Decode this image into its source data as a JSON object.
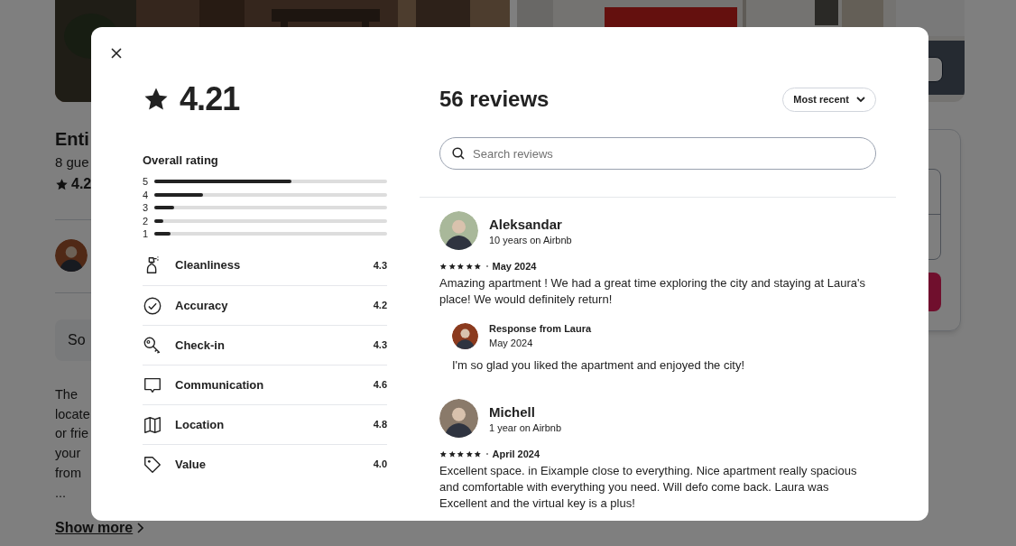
{
  "background": {
    "title": "Enti",
    "subtitle": "8 gue",
    "rating": "4.2",
    "highlight": "So",
    "description": [
      "The",
      "locate",
      "or frie",
      "your",
      "from",
      "..."
    ],
    "show_more": "Show more"
  },
  "modal": {
    "overall_score": "4.21",
    "overall_label": "Overall rating",
    "distribution": [
      {
        "label": "5",
        "level": 0.59
      },
      {
        "label": "4",
        "level": 0.21
      },
      {
        "label": "3",
        "level": 0.085
      },
      {
        "label": "2",
        "level": 0.04
      },
      {
        "label": "1",
        "level": 0.07
      }
    ],
    "categories": [
      {
        "kind": "cleanliness",
        "label": "Cleanliness",
        "score": "4.3"
      },
      {
        "kind": "accuracy",
        "label": "Accuracy",
        "score": "4.2"
      },
      {
        "kind": "checkin",
        "label": "Check-in",
        "score": "4.3"
      },
      {
        "kind": "communication",
        "label": "Communication",
        "score": "4.6"
      },
      {
        "kind": "location",
        "label": "Location",
        "score": "4.8"
      },
      {
        "kind": "value",
        "label": "Value",
        "score": "4.0"
      }
    ],
    "reviews_title": "56 reviews",
    "sort": "Most recent",
    "search": {
      "placeholder": "Search reviews"
    },
    "reviews": [
      {
        "name": "Aleksandar",
        "tenure": "10 years on Airbnb",
        "stars": 5,
        "date": "May 2024",
        "text": "Amazing apartment ! We had a great time exploring the city and staying at Laura's place! We would definitely return!",
        "response": {
          "title": "Response from Laura",
          "date": "May 2024",
          "text": "I'm so glad you liked the apartment and enjoyed the city!"
        }
      },
      {
        "name": "Michell",
        "tenure": "1 year on Airbnb",
        "stars": 5,
        "date": "April 2024",
        "text": "Excellent space. in Eixample close to everything. Nice apartment really spacious and comfortable with everything you need. Will defo come back. Laura was Excellent and the virtual key is a plus!"
      }
    ]
  }
}
